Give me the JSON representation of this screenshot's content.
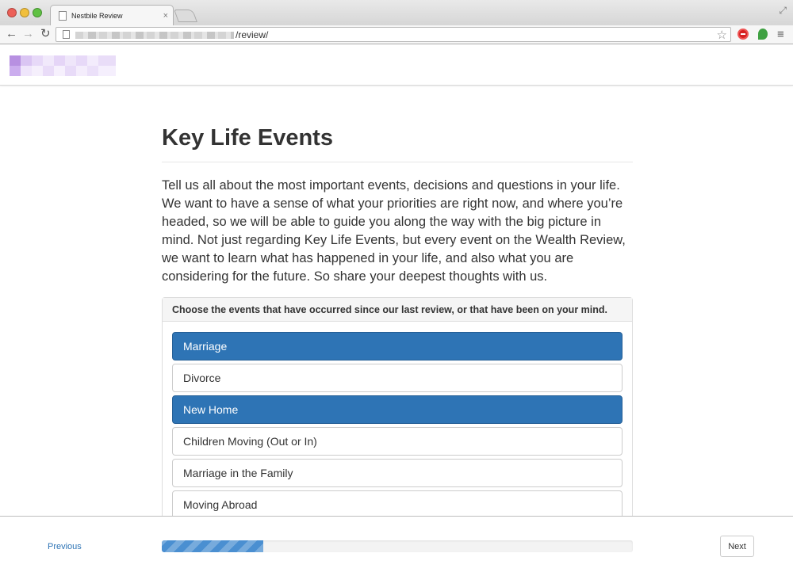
{
  "browser": {
    "tab_title": "Nestbile Review",
    "url_path": "/review/"
  },
  "page": {
    "title": "Key Life Events",
    "intro": "Tell us all about the most important events, decisions and questions in your life. We want to have a sense of what your priorities are right now, and where you’re headed, so we will be able to guide you along the way with the big picture in mind. Not just regarding Key Life Events, but every event on the Wealth Review, we want to learn what has happened in your life, and also what you are considering for the future. So share your deepest thoughts with us."
  },
  "events_panel": {
    "heading": "Choose the events that have occurred since our last review, or that have been on your mind.",
    "items": [
      {
        "label": "Marriage",
        "selected": true
      },
      {
        "label": "Divorce",
        "selected": false
      },
      {
        "label": "New Home",
        "selected": true
      },
      {
        "label": "Children Moving (Out or In)",
        "selected": false
      },
      {
        "label": "Marriage in the Family",
        "selected": false
      },
      {
        "label": "Moving Abroad",
        "selected": false
      }
    ]
  },
  "footer": {
    "previous_label": "Previous",
    "next_label": "Next",
    "progress_fraction": 0.215
  },
  "colors": {
    "selected": "#2e74b5",
    "link": "#2e74b5",
    "progress": "#4a8fd1"
  },
  "icons": [
    "close-icon",
    "page-icon",
    "back-arrow-icon",
    "forward-arrow-icon",
    "reload-icon",
    "star-icon",
    "stop-extension-icon",
    "leaf-extension-icon",
    "menu-icon",
    "fullscreen-icon"
  ]
}
